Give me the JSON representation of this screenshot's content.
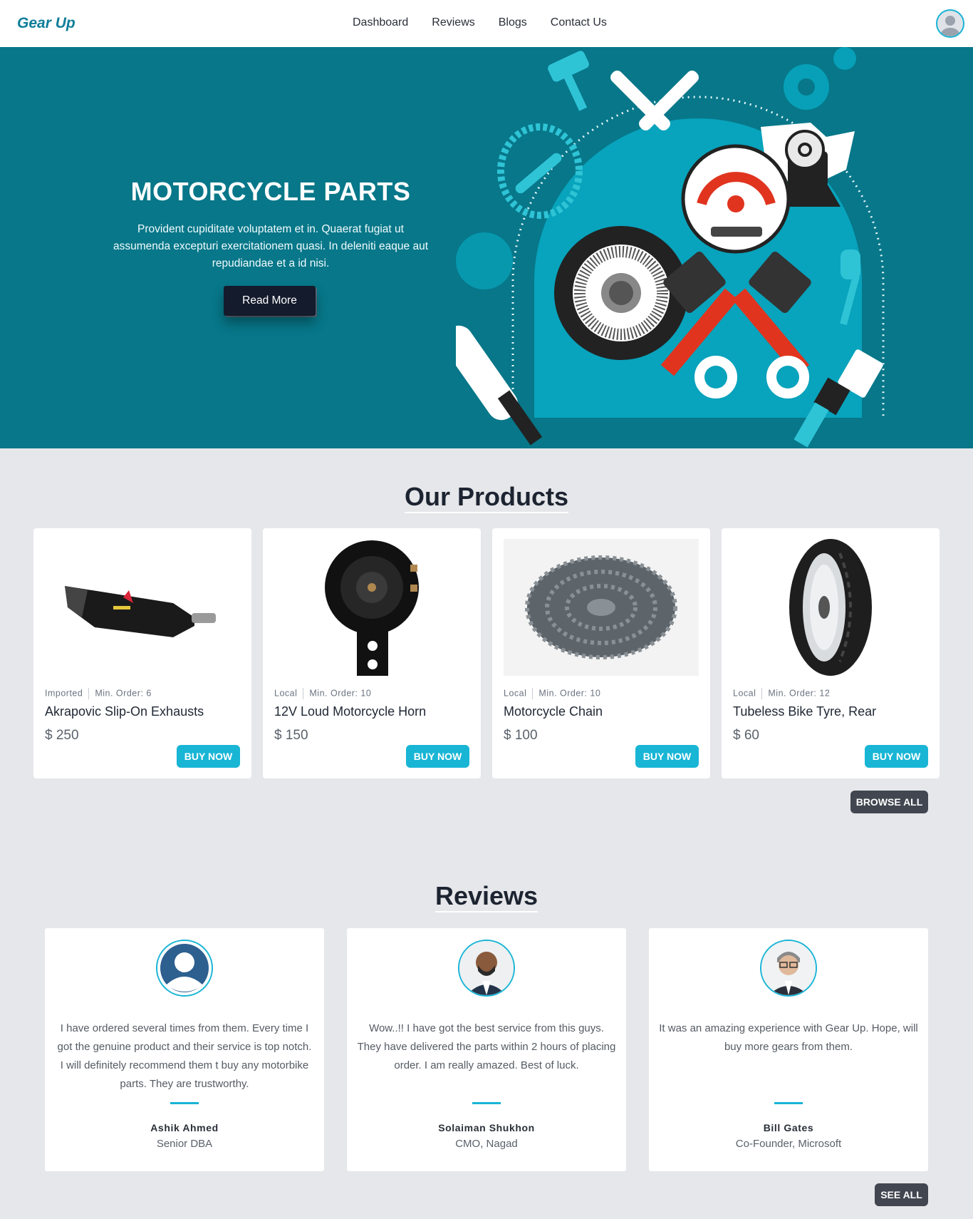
{
  "navbar": {
    "brand": "Gear Up",
    "links": [
      "Dashboard",
      "Reviews",
      "Blogs",
      "Contact Us"
    ]
  },
  "hero": {
    "title": "MOTORCYCLE PARTS",
    "text": "Provident cupiditate voluptatem et in. Quaerat fugiat ut assumenda excepturi exercitationem quasi. In deleniti eaque aut repudiandae et a id nisi.",
    "button": "Read More"
  },
  "products": {
    "title": "Our Products",
    "items": [
      {
        "origin": "Imported",
        "min_order": "Min. Order: 6",
        "name": "Akrapovic Slip-On Exhausts",
        "price": "$ 250",
        "button": "BUY NOW",
        "image": "exhaust-image"
      },
      {
        "origin": "Local",
        "min_order": "Min. Order: 10",
        "name": "12V Loud Motorcycle Horn",
        "price": "$ 150",
        "button": "BUY NOW",
        "image": "horn-image"
      },
      {
        "origin": "Local",
        "min_order": "Min. Order: 10",
        "name": "Motorcycle Chain",
        "price": "$ 100",
        "button": "BUY NOW",
        "image": "chain-image"
      },
      {
        "origin": "Local",
        "min_order": "Min. Order: 12",
        "name": "Tubeless Bike Tyre, Rear",
        "price": "$ 60",
        "button": "BUY NOW",
        "image": "tyre-image"
      }
    ],
    "browse_all": "BROWSE ALL"
  },
  "reviews": {
    "title": "Reviews",
    "items": [
      {
        "text": "I have ordered several times from them. Every time I got the genuine product and their service is top notch. I will definitely recommend them t buy any motorbike parts. They are trustworthy.",
        "name": "Ashik Ahmed",
        "role": "Senior DBA"
      },
      {
        "text": "Wow..!! I have got the best service from this guys. They have delivered the parts within 2 hours of placing order. I am really amazed. Best of luck.",
        "name": "Solaiman Shukhon",
        "role": "CMO, Nagad"
      },
      {
        "text": "It was an amazing experience with Gear Up. Hope, will buy more gears from them.",
        "name": "Bill Gates",
        "role": "Co-Founder, Microsoft"
      }
    ],
    "see_all": "SEE ALL"
  },
  "colors": {
    "accent": "#19b5d5",
    "hero_bg": "#077789",
    "page_bg": "#e6e7ea",
    "dark_button": "#414650"
  }
}
